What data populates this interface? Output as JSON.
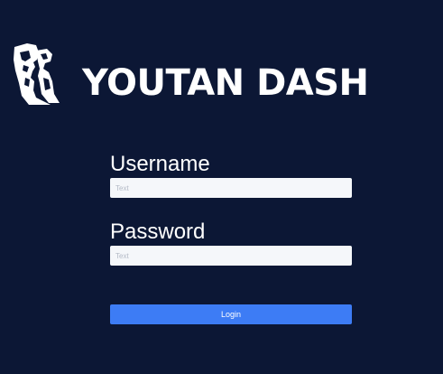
{
  "brand": {
    "title": "YOUTAN DASH",
    "logo_icon": "moai-statue-icon"
  },
  "login_form": {
    "username_label": "Username",
    "username_placeholder": "Text",
    "username_value": "",
    "password_label": "Password",
    "password_placeholder": "Text",
    "password_value": "",
    "login_label": "Login"
  },
  "colors": {
    "background": "#0c1735",
    "input_background": "#f5f7fa",
    "button": "#3d7cf5",
    "text": "#ffffff"
  }
}
